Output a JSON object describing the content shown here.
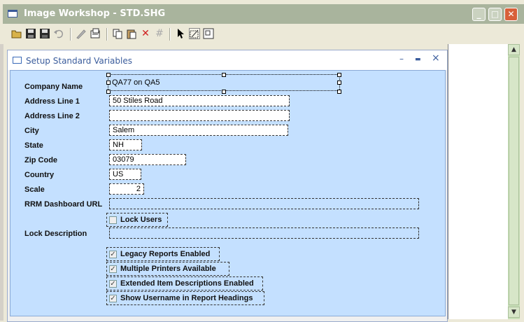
{
  "window": {
    "title": "Image Workshop - STD.SHG",
    "buttons": {
      "minimize": "_",
      "maximize": "□",
      "close": "✕"
    }
  },
  "toolbar": {
    "icons": [
      "open-icon",
      "save-icon",
      "save-all-icon",
      "undo-icon",
      "pencil-icon",
      "properties-icon",
      "copy-icon",
      "paste-icon",
      "delete-icon",
      "grid-icon",
      "pointer-icon",
      "edit-mode-icon",
      "resize-icon"
    ]
  },
  "child": {
    "title": "Setup Standard Variables",
    "buttons": {
      "minimize": "–",
      "maximize": "▬",
      "close": "×"
    }
  },
  "form": {
    "labels": {
      "company_name": "Company Name",
      "address1": "Address Line 1",
      "address2": "Address Line 2",
      "city": "City",
      "state": "State",
      "zip": "Zip Code",
      "country": "Country",
      "scale": "Scale",
      "rrm_url": "RRM Dashboard URL",
      "lock_description": "Lock Description"
    },
    "values": {
      "company_name": "QA77 on QA5",
      "address1": "50 Stiles Road",
      "address2": "",
      "city": "Salem",
      "state": "NH",
      "zip": "03079",
      "country": "US",
      "scale": "2",
      "rrm_url": "",
      "lock_description": ""
    },
    "checkboxes": {
      "lock_users": {
        "label": "Lock Users",
        "checked": false
      },
      "legacy_reports": {
        "label": "Legacy Reports Enabled",
        "checked": true
      },
      "multiple_printers": {
        "label": "Multiple Printers Available",
        "checked": true
      },
      "extended_item": {
        "label": "Extended Item Descriptions Enabled",
        "checked": true
      },
      "show_username": {
        "label": "Show Username in Report Headings",
        "checked": true
      }
    }
  },
  "colors": {
    "titlebar": "#a9b49d",
    "form_background": "#c4e0ff",
    "close_button": "#d8603a"
  }
}
